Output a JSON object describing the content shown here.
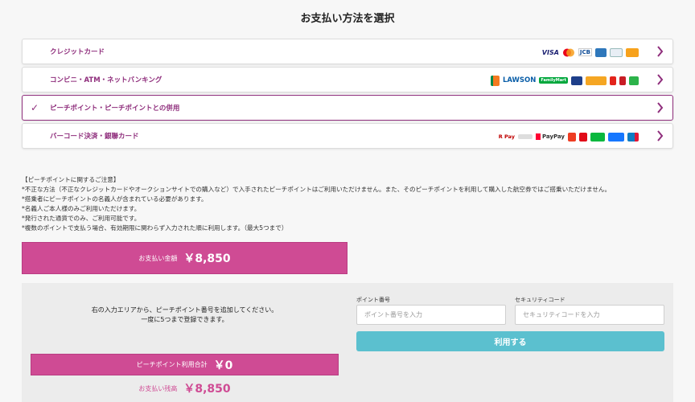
{
  "page_title": "お支払い方法を選択",
  "methods": [
    {
      "label": "クレジットカード",
      "logos": [
        "VISA",
        "JCB"
      ]
    },
    {
      "label": "コンビニ・ATM・ネットバンキング",
      "logos": [
        "LAWSON",
        "FamilyMart"
      ]
    },
    {
      "label": "ピーチポイント・ピーチポイントとの併用",
      "selected": true
    },
    {
      "label": "バーコード決済・銀聯カード",
      "logos": [
        "R Pay",
        "PayPay"
      ]
    }
  ],
  "notes": [
    "【ピーチポイントに関するご注意】",
    "*不正な方法（不正なクレジットカードやオークションサイトでの購入など）で入手されたピーチポイントはご利用いただけません。また、そのピーチポイントを利用して購入した航空券ではご搭乗いただけません。",
    "*搭乗者にピーチポイントの名義人が含まれている必要があります。",
    "*名義人ご本人様のみご利用いただけます。",
    "*発行された通貨でのみ、ご利用可能です。",
    "*複数のポイントで支払う場合、有効期限に関わらず入力された順に利用します。（最大5つまで）"
  ],
  "total": {
    "caption": "お支払い金額",
    "amount": "￥8,850"
  },
  "panel": {
    "message_line1": "右の入力エリアから、ピーチポイント番号を追加してください。",
    "message_line2": "一度に5つまで登録できます。",
    "point_label": "ポイント番号",
    "point_placeholder": "ポイント番号を入力",
    "security_label": "セキュリティコード",
    "security_placeholder": "セキュリティコードを入力",
    "use_button": "利用する",
    "subtotal_caption": "ピーチポイント利用合計",
    "subtotal_amount": "￥0",
    "remaining_caption": "お支払い残高",
    "remaining_amount": "￥8,850"
  },
  "colors": {
    "accent": "#8f2e7c",
    "pink": "#cf4b94",
    "teal": "#5bc0cf"
  }
}
